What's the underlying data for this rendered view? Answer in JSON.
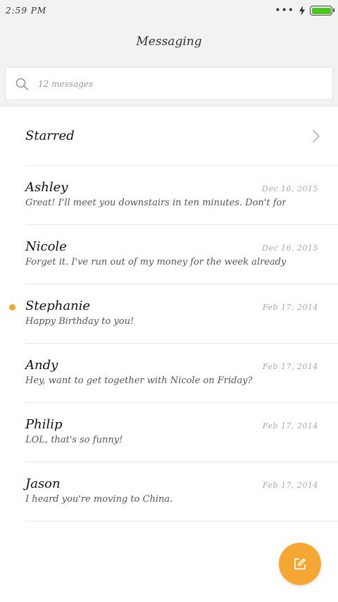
{
  "status_bar": {
    "time": "2:59 PM",
    "more_dots": "•••",
    "battery_color": "#4cc51f"
  },
  "header": {
    "title": "Messaging"
  },
  "search": {
    "placeholder": "12 messages",
    "icon": "search-icon"
  },
  "starred": {
    "label": "Starred",
    "icon": "chevron-right-icon"
  },
  "messages": [
    {
      "name": "Ashley",
      "date": "Dec 16, 2015",
      "preview": "Great! I'll meet you downstairs in ten minutes. Don't forge",
      "unread": false
    },
    {
      "name": "Nicole",
      "date": "Dec 16, 2015",
      "preview": "Forget it. I've run out of my money for the week already.",
      "unread": false
    },
    {
      "name": "Stephanie",
      "date": "Feb 17, 2014",
      "preview": "Happy Birthday to you!",
      "unread": true
    },
    {
      "name": "Andy",
      "date": "Feb 17, 2014",
      "preview": "Hey, want to get together with Nicole on Friday?",
      "unread": false
    },
    {
      "name": "Philip",
      "date": "Feb 17, 2014",
      "preview": "LOL, that's so funny!",
      "unread": false
    },
    {
      "name": "Jason",
      "date": "Feb 17, 2014",
      "preview": "I heard you're moving to China.",
      "unread": false
    }
  ],
  "colors": {
    "accent": "#f4a833"
  },
  "fab": {
    "icon": "compose-icon"
  }
}
